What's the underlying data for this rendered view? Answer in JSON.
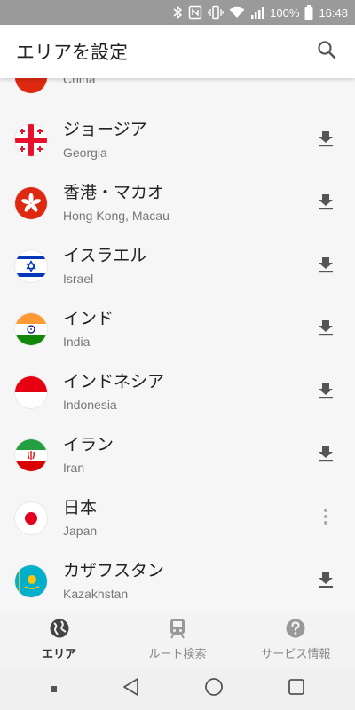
{
  "status_bar": {
    "battery": "100%",
    "time": "16:48"
  },
  "app_bar": {
    "title": "エリアを設定"
  },
  "colors": {
    "accent": "#555555",
    "status_bg": "#9a9a9a"
  },
  "areas": [
    {
      "name": "",
      "sub": "China",
      "flag": "china-flag-icon",
      "action": "none"
    },
    {
      "name": "ジョージア",
      "sub": "Georgia",
      "flag": "georgia-flag-icon",
      "action": "download"
    },
    {
      "name": "香港・マカオ",
      "sub": "Hong Kong, Macau",
      "flag": "hongkong-flag-icon",
      "action": "download"
    },
    {
      "name": "イスラエル",
      "sub": "Israel",
      "flag": "israel-flag-icon",
      "action": "download"
    },
    {
      "name": "インド",
      "sub": "India",
      "flag": "india-flag-icon",
      "action": "download"
    },
    {
      "name": "インドネシア",
      "sub": "Indonesia",
      "flag": "indonesia-flag-icon",
      "action": "download"
    },
    {
      "name": "イラン",
      "sub": "Iran",
      "flag": "iran-flag-icon",
      "action": "download"
    },
    {
      "name": "日本",
      "sub": "Japan",
      "flag": "japan-flag-icon",
      "action": "more"
    },
    {
      "name": "カザフスタン",
      "sub": "Kazakhstan",
      "flag": "kazakhstan-flag-icon",
      "action": "download"
    }
  ],
  "bottom_nav": {
    "area": "エリア",
    "route": "ルート検索",
    "service": "サービス情報"
  }
}
